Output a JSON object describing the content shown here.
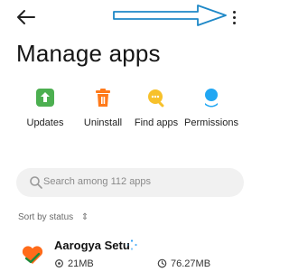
{
  "header": {
    "back_icon": "back-arrow-icon",
    "more_icon": "more-vert-icon",
    "title": "Manage apps"
  },
  "actions": [
    {
      "label": "Updates",
      "icon": "updates-icon",
      "color": "#4caf50"
    },
    {
      "label": "Uninstall",
      "icon": "uninstall-icon",
      "color": "#ff7a1a"
    },
    {
      "label": "Find apps",
      "icon": "find-apps-icon",
      "color": "#f7c12b"
    },
    {
      "label": "Permissions",
      "icon": "permissions-icon",
      "color": "#21a7f3"
    }
  ],
  "search": {
    "placeholder": "Search among 112 apps"
  },
  "sort": {
    "label": "Sort by status"
  },
  "apps": [
    {
      "name": "Aarogya Setu",
      "app_size": "21MB",
      "storage": "76.27MB"
    }
  ],
  "accent_colors": {
    "annotation_arrow": "#1e88c7"
  }
}
